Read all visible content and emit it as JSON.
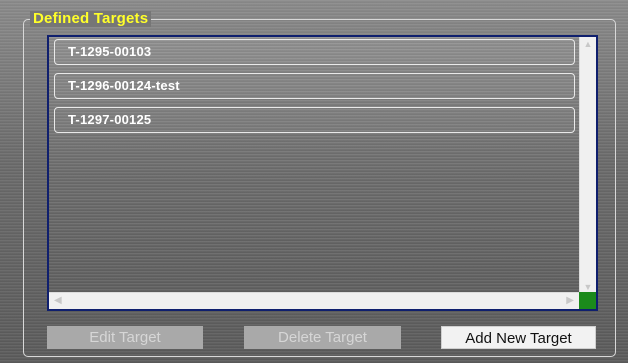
{
  "group": {
    "title": "Defined Targets"
  },
  "targets": [
    {
      "label": "T-1295-00103"
    },
    {
      "label": "T-1296-00124-test"
    },
    {
      "label": "T-1297-00125"
    }
  ],
  "buttons": {
    "edit": "Edit Target",
    "delete": "Delete Target",
    "add": "Add New Target"
  },
  "colors": {
    "title": "#ffff2a",
    "list_border": "#0f1f6e",
    "corner_indicator": "#1b8a1b"
  }
}
